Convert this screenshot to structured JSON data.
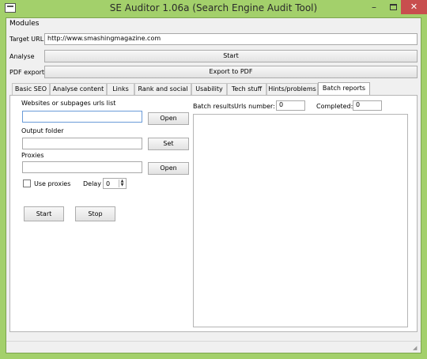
{
  "window": {
    "title": "SE Auditor 1.06a (Search Engine Audit Tool)",
    "controls": {
      "minimize": "–",
      "close": "✕"
    },
    "accent": "#a3d06b",
    "close_color": "#c84e4e"
  },
  "menu": {
    "modules": "Modules"
  },
  "form": {
    "target_url_label": "Target URL",
    "target_url_value": "http://www.smashingmagazine.com",
    "analyse_label": "Analyse",
    "start_label": "Start",
    "pdf_label": "PDF export",
    "export_label": "Export to PDF"
  },
  "tabs": [
    {
      "label": "Basic SEO"
    },
    {
      "label": "Analyse content"
    },
    {
      "label": "Links"
    },
    {
      "label": "Rank and social"
    },
    {
      "label": "Usability"
    },
    {
      "label": "Tech stuff"
    },
    {
      "label": "Hints/problems"
    },
    {
      "label": "Batch reports",
      "active": true
    }
  ],
  "batch": {
    "urls_list_label": "Websites or subpages urls list",
    "urls_value": "",
    "open_label": "Open",
    "output_folder_label": "Output folder",
    "output_value": "",
    "set_label": "Set",
    "proxies_label": "Proxies",
    "proxies_value": "",
    "proxies_open_label": "Open",
    "use_proxies_label": "Use proxies",
    "use_proxies_checked": false,
    "delay_label": "Delay",
    "delay_value": "0",
    "start_label": "Start",
    "stop_label": "Stop",
    "results_label": "Batch results",
    "urls_number_label": "Urls number:",
    "urls_number_value": "0",
    "completed_label": "Completed:",
    "completed_value": "0"
  }
}
